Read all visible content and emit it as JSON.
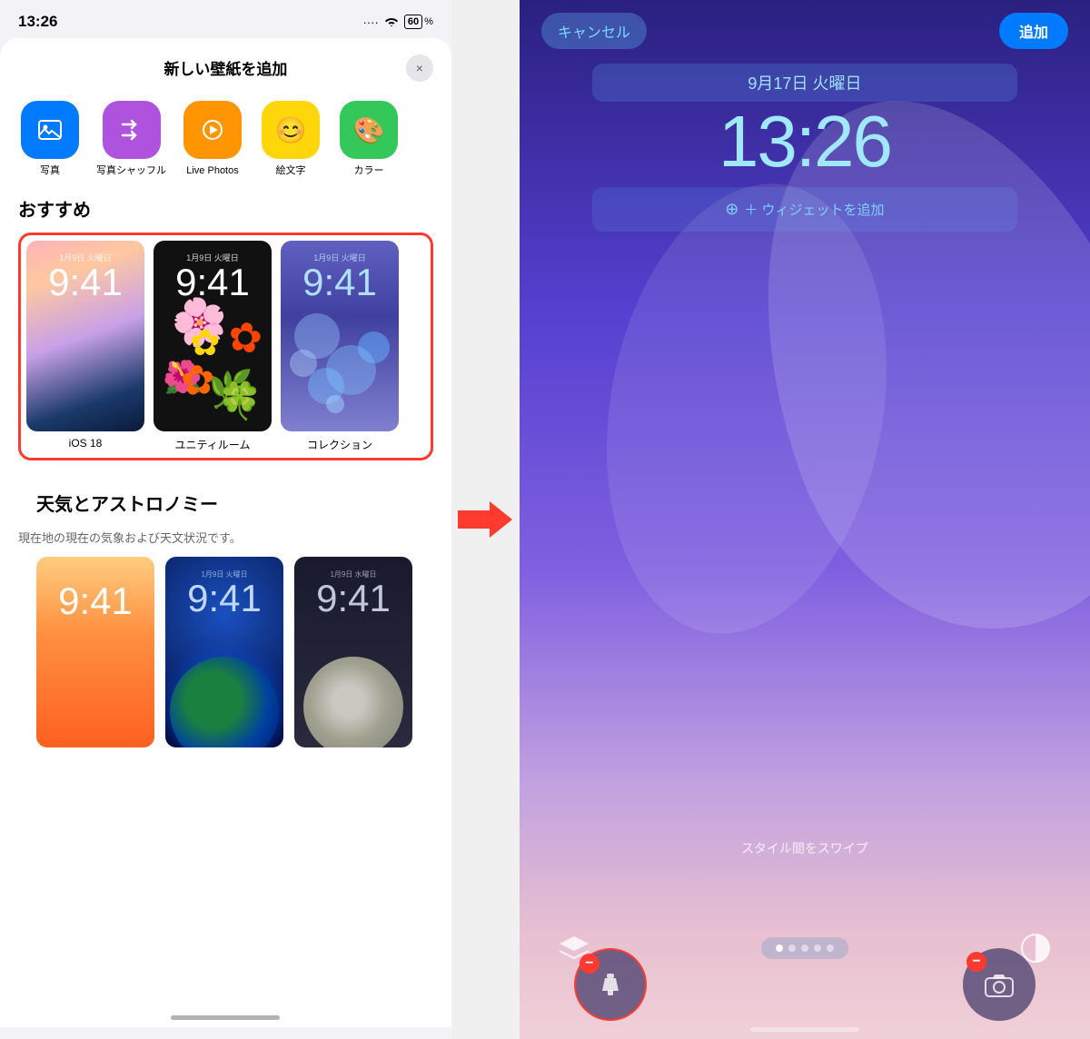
{
  "left": {
    "status_time": "13:26",
    "status_dots": "····",
    "status_wifi": "WiFi",
    "status_battery": "60",
    "sheet_title": "新しい壁紙を追加",
    "sheet_close": "×",
    "categories": [
      {
        "id": "photos",
        "label": "写真",
        "icon": "🖼️",
        "color": "cat-blue"
      },
      {
        "id": "shuffle",
        "label": "写真シャッフル",
        "icon": "🔀",
        "color": "cat-purple"
      },
      {
        "id": "livephotos",
        "label": "Live Photos",
        "icon": "▶",
        "color": "cat-orange"
      },
      {
        "id": "emoji",
        "label": "絵文字",
        "icon": "😊",
        "color": "cat-yellow"
      },
      {
        "id": "color",
        "label": "カラー",
        "icon": "🎨",
        "color": "cat-green"
      }
    ],
    "section_recommended": "おすすめ",
    "wallpapers_recommended": [
      {
        "id": "ios18",
        "label": "iOS 18",
        "time_small": "1月9日 火曜日",
        "time_large": "9:41"
      },
      {
        "id": "unity",
        "label": "ユニティルーム",
        "time_small": "1月9日 火曜日",
        "time_large": "9:41"
      },
      {
        "id": "collection",
        "label": "コレクション",
        "time_small": "1月9日 火曜日",
        "time_large": "9:41"
      }
    ],
    "section_weather": "天気とアストロノミー",
    "weather_desc": "現在地の現在の気象および天文状況です。",
    "wallpapers_weather": [
      {
        "id": "weather1",
        "time_large": "9:41"
      },
      {
        "id": "weather2",
        "time_small": "1月9日 火曜日",
        "time_large": "9:41"
      },
      {
        "id": "weather3",
        "time_small": "1月9日 水曜日",
        "time_large": "9:41"
      }
    ]
  },
  "right": {
    "btn_cancel": "キャンセル",
    "btn_add": "追加",
    "lock_date": "9月17日 火曜日",
    "lock_time": "13:26",
    "widget_add_label": "＋ ウィジェットを追加",
    "swipe_hint": "スタイル間をスワイプ",
    "home_indicator": ""
  }
}
